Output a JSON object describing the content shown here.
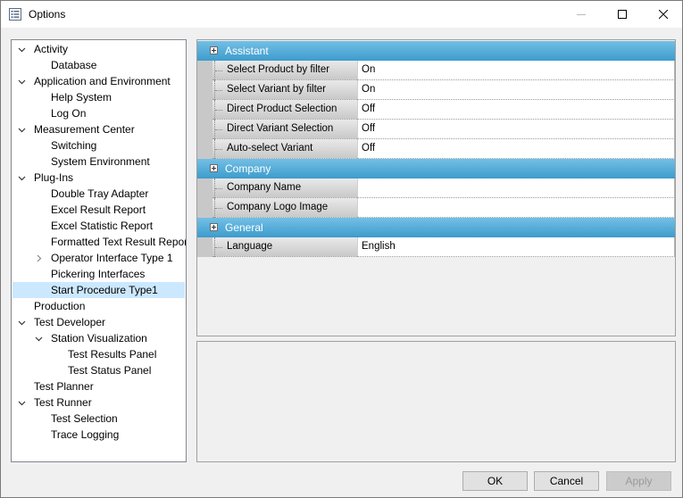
{
  "window": {
    "title": "Options",
    "icon": "options-list-icon",
    "controls": [
      "minimize-icon",
      "maximize-icon",
      "close-icon"
    ]
  },
  "tree": {
    "items": [
      {
        "label": "Activity",
        "level": 0,
        "expander": "expanded"
      },
      {
        "label": "Database",
        "level": 1,
        "expander": "none"
      },
      {
        "label": "Application and Environment",
        "level": 0,
        "expander": "expanded"
      },
      {
        "label": "Help System",
        "level": 1,
        "expander": "none"
      },
      {
        "label": "Log On",
        "level": 1,
        "expander": "none"
      },
      {
        "label": "Measurement Center",
        "level": 0,
        "expander": "expanded"
      },
      {
        "label": "Switching",
        "level": 1,
        "expander": "none"
      },
      {
        "label": "System Environment",
        "level": 1,
        "expander": "none"
      },
      {
        "label": "Plug-Ins",
        "level": 0,
        "expander": "expanded"
      },
      {
        "label": "Double Tray Adapter",
        "level": 1,
        "expander": "none"
      },
      {
        "label": "Excel Result Report",
        "level": 1,
        "expander": "none"
      },
      {
        "label": "Excel Statistic Report",
        "level": 1,
        "expander": "none"
      },
      {
        "label": "Formatted Text Result Report",
        "level": 1,
        "expander": "none"
      },
      {
        "label": "Operator Interface Type 1",
        "level": 1,
        "expander": "collapsed"
      },
      {
        "label": "Pickering Interfaces",
        "level": 1,
        "expander": "none"
      },
      {
        "label": "Start Procedure Type1",
        "level": 1,
        "expander": "none",
        "selected": true
      },
      {
        "label": "Production",
        "level": 0,
        "expander": "none"
      },
      {
        "label": "Test Developer",
        "level": 0,
        "expander": "expanded"
      },
      {
        "label": "Station Visualization",
        "level": 1,
        "expander": "expanded"
      },
      {
        "label": "Test Results Panel",
        "level": 2,
        "expander": "none"
      },
      {
        "label": "Test Status Panel",
        "level": 2,
        "expander": "none"
      },
      {
        "label": "Test Planner",
        "level": 0,
        "expander": "none"
      },
      {
        "label": "Test Runner",
        "level": 0,
        "expander": "expanded"
      },
      {
        "label": "Test Selection",
        "level": 1,
        "expander": "none"
      },
      {
        "label": "Trace Logging",
        "level": 1,
        "expander": "none"
      }
    ]
  },
  "property_grid": {
    "categories": [
      {
        "label": "Assistant",
        "properties": [
          {
            "name": "Select Product by filter",
            "value": "On"
          },
          {
            "name": "Select Variant by filter",
            "value": "On"
          },
          {
            "name": "Direct Product Selection",
            "value": "Off"
          },
          {
            "name": "Direct Variant Selection",
            "value": "Off"
          },
          {
            "name": "Auto-select Variant",
            "value": "Off"
          }
        ]
      },
      {
        "label": "Company",
        "properties": [
          {
            "name": "Company Name",
            "value": ""
          },
          {
            "name": "Company Logo Image",
            "value": ""
          }
        ]
      },
      {
        "label": "General",
        "properties": [
          {
            "name": "Language",
            "value": "English"
          }
        ]
      }
    ]
  },
  "buttons": {
    "ok": "OK",
    "cancel": "Cancel",
    "apply": "Apply"
  },
  "colors": {
    "category_header": "#4aa8d8",
    "selection": "#cce8ff"
  }
}
